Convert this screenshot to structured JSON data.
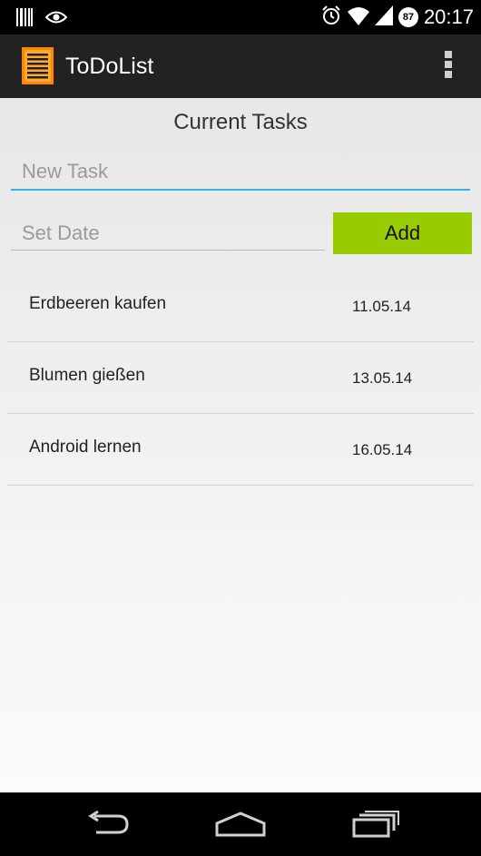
{
  "status_bar": {
    "time": "20:17",
    "battery_level": "87",
    "icons": [
      "barcode-icon",
      "eye-icon",
      "alarm-icon",
      "wifi-icon",
      "signal-icon",
      "battery-icon"
    ]
  },
  "action_bar": {
    "title": "ToDoList",
    "logo_icon": "notepad-icon",
    "overflow_icon": "overflow-menu-icon",
    "logo_color": "#ff8800"
  },
  "main": {
    "heading": "Current Tasks",
    "new_task_placeholder": "New Task",
    "new_task_value": "",
    "date_placeholder": "Set Date",
    "date_value": "",
    "add_label": "Add",
    "add_color": "#99cc00",
    "focus_color": "#33b5e5"
  },
  "tasks": [
    {
      "name": "Erdbeeren kaufen",
      "date": "11.05.14"
    },
    {
      "name": "Blumen gießen",
      "date": "13.05.14"
    },
    {
      "name": "Android lernen",
      "date": "16.05.14"
    }
  ],
  "nav_bar": {
    "icons": [
      "back-icon",
      "home-icon",
      "recents-icon"
    ]
  }
}
